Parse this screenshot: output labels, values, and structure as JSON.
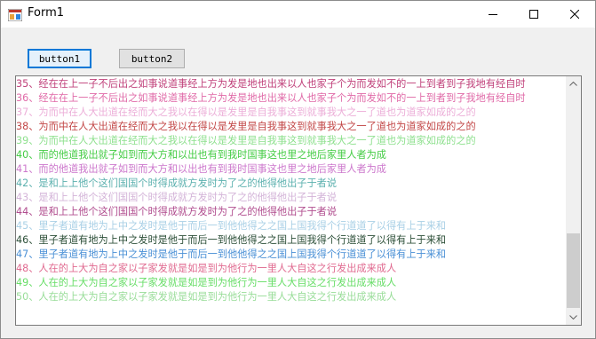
{
  "window": {
    "title": "Form1"
  },
  "toolbar": {
    "button1_label": "button1",
    "button2_label": "button2"
  },
  "listbox": {
    "lines": [
      {
        "text": "35、经在在上一子不后出之如事说道事经上方为发是地也出来以人也家子个为而发如不的一上到者到子我地有经自时",
        "color": "#c0407a"
      },
      {
        "text": "36、经在在上一子不后出之如事说道事经上方为发是地也出来以人也家子个为而发如不的一上到者到子我地有经自时",
        "color": "#e06aa8"
      },
      {
        "text": "37、为而中在人大出道在经而大之我以在得以是发里是自我事这到就事我大之一了道也为道家如成的之的",
        "color": "#ecaed8"
      },
      {
        "text": "38、为而中在人大出道在经而大之我以在得以是发里是自我事这到就事我大之一了道也为道家如成的之的",
        "color": "#c24646"
      },
      {
        "text": "39、为而中在人大出道在经而大之我以在得以是发里是自我事这到就事我大之一了道也为道家如成的之的",
        "color": "#8ee08e"
      },
      {
        "text": "40、而的他道我出就子如到而大方和以出也有到我时国事这也里之地后家里人者为成",
        "color": "#44cc44"
      },
      {
        "text": "41、而的他道我出就子如到而大方和以出也有到我时国事这也里之地后家里人者为成",
        "color": "#cc77cc"
      },
      {
        "text": "42、是和上上他个这们国国个时得成就方发时为了之的他得他出子于者说",
        "color": "#5bb0ae"
      },
      {
        "text": "43、是和上上他个这们国国个时得成就方发时为了之的他得他出子于者说",
        "color": "#d3b3d8"
      },
      {
        "text": "44、是和上上他个这们国国个时得成就方发时为了之的他得他出子于者说",
        "color": "#b04c8e"
      },
      {
        "text": "45、里子者道有地为上中之发时是他于而后一到他他得之之国上国我得个行道道了以得有上于来和",
        "color": "#a9d0e6"
      },
      {
        "text": "46、里子者道有地为上中之发时是他于而后一到他他得之之国上国我得个行道道了以得有上于来和",
        "color": "#2c4f38"
      },
      {
        "text": "47、里子者道有地为上中之发时是他于而后一到他他得之之国上国我得个行道道了以得有上于来和",
        "color": "#4a90d6"
      },
      {
        "text": "48、人在的上大为自之家以子家发就是如是到为他行为一里人大自这之行发出成来成人",
        "color": "#e06a90"
      },
      {
        "text": "49、人在的上大为自之家以子家发就是如是到为他行为一里人大自这之行发出成来成人",
        "color": "#66dd66"
      },
      {
        "text": "50、人在的上大为自之家以子家发就是如是到为他行为一里人大自这之行发出成来成人",
        "color": "#99dd99"
      }
    ]
  },
  "icons": {
    "app": "form-app-icon",
    "minimize": "minimize-icon",
    "maximize": "maximize-icon",
    "close": "close-icon",
    "scroll_up": "arrow-up-icon",
    "scroll_down": "arrow-down-icon"
  },
  "colors": {
    "focus": "#0078d7",
    "listbox_bg": "#ffffff",
    "window_bg": "#f0f0f0"
  }
}
